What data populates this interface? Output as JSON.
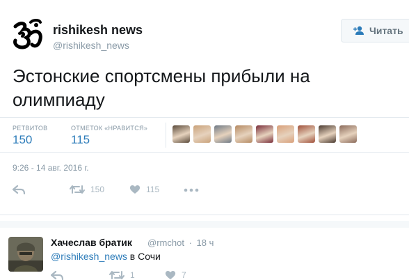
{
  "tweet": {
    "author_name": "rishikesh news",
    "author_handle": "@rishikesh_news",
    "follow_label": "Читать",
    "text": "Эстонские спортсмены прибыли на олимпиаду",
    "retweets_label": "РЕТВИТОВ",
    "retweets_count": "150",
    "likes_label": "ОТМЕТОК «НРАВИТСЯ»",
    "likes_count": "115",
    "timestamp": "9:26 - 14 авг. 2016 г.",
    "action_retweets": "150",
    "action_likes": "115"
  },
  "reply": {
    "author_name": "Хачеслав братик",
    "author_handle": "@rmchot",
    "separator": "·",
    "time": "18 ч",
    "mention": "@rishikesh_news",
    "text_rest": " в Сочи",
    "action_retweets": "1",
    "action_likes": "7"
  },
  "colors": {
    "link": "#2b7bb9",
    "muted": "#8899a6",
    "icon": "#aab8c2"
  },
  "faces": [
    "#5a4a3a",
    "#c9a27a",
    "#6f7a86",
    "#b58a62",
    "#7a2e3a",
    "#d9a07a",
    "#a0503a",
    "#4a3a30",
    "#8a6a5a"
  ],
  "icons": [
    "om-logo-icon",
    "follow-icon",
    "reply-icon",
    "retweet-icon",
    "heart-icon",
    "more-icon"
  ]
}
